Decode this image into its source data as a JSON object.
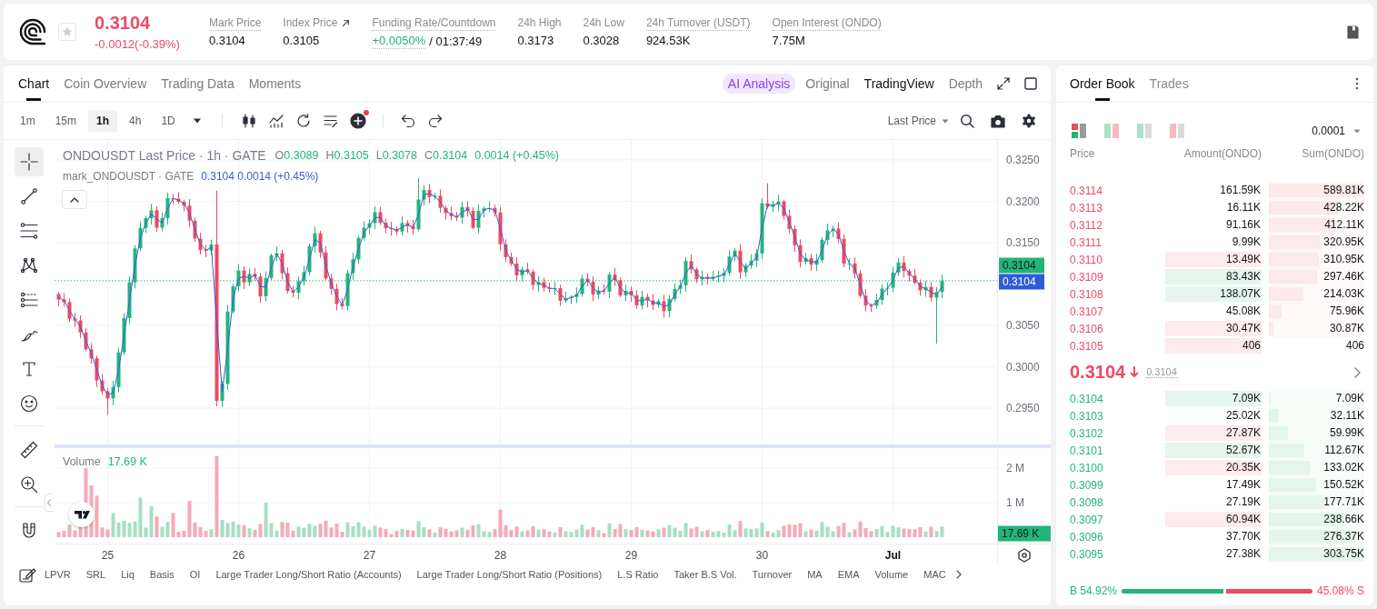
{
  "header": {
    "last_price": "0.3104",
    "change": "-0.0012(-0.39%)",
    "falling": true,
    "favorite": false,
    "stats": [
      {
        "kind": "plain",
        "label": "Mark Price",
        "tooltip": true,
        "value": "0.3104"
      },
      {
        "kind": "link",
        "label": "Index Price",
        "tooltip": false,
        "value": "0.3105"
      },
      {
        "kind": "funding",
        "label": "Funding Rate/Countdown",
        "tooltip": true,
        "value": "+0.0050%",
        "countdown": "/ 01:37:49"
      },
      {
        "kind": "plain",
        "label": "24h High",
        "tooltip": false,
        "value": "0.3173"
      },
      {
        "kind": "plain",
        "label": "24h Low",
        "tooltip": false,
        "value": "0.3028"
      },
      {
        "kind": "plain",
        "label": "24h Turnover (USDT)",
        "tooltip": true,
        "value": "924.53K"
      },
      {
        "kind": "plain",
        "label": "Open Interest (ONDO)",
        "tooltip": true,
        "value": "7.75M"
      }
    ]
  },
  "chart_panel": {
    "tabs": [
      {
        "label": "Chart",
        "selected": true
      },
      {
        "label": "Coin Overview",
        "selected": false
      },
      {
        "label": "Trading Data",
        "selected": false
      },
      {
        "label": "Moments",
        "selected": false
      }
    ],
    "ai_analysis": "AI Analysis",
    "views": [
      {
        "label": "Original",
        "selected": false
      },
      {
        "label": "TradingView",
        "selected": true
      },
      {
        "label": "Depth",
        "selected": false
      }
    ],
    "intervals": [
      {
        "label": "1m",
        "selected": false
      },
      {
        "label": "15m",
        "selected": false
      },
      {
        "label": "1h",
        "selected": true
      },
      {
        "label": "4h",
        "selected": false
      },
      {
        "label": "1D",
        "selected": false
      }
    ],
    "indicator_badge": true,
    "price_source": "Last Price",
    "drawing_tools": [
      [
        {
          "kind": "crosshair",
          "selected": true
        },
        {
          "kind": "trend-line",
          "selected": false
        },
        {
          "kind": "horizontal-lines",
          "selected": false
        },
        {
          "kind": "pattern",
          "selected": false
        },
        {
          "kind": "channel",
          "selected": false
        },
        {
          "kind": "brush",
          "selected": false
        },
        {
          "kind": "text",
          "selected": false
        },
        {
          "kind": "emoji",
          "selected": false
        }
      ],
      [
        {
          "kind": "ruler",
          "selected": false
        },
        {
          "kind": "zoom-in",
          "selected": false
        }
      ],
      [
        {
          "kind": "magnet",
          "selected": false
        }
      ]
    ],
    "legend": {
      "title": "ONDOUSDT Last Price · 1h · GATE",
      "ohlc": [
        {
          "key": "O",
          "value": "0.3089"
        },
        {
          "key": "H",
          "value": "0.3105"
        },
        {
          "key": "L",
          "value": "0.3078"
        },
        {
          "key": "C",
          "value": "0.3104"
        }
      ],
      "change": "0.0014 (+0.45%)",
      "mark_title": "mark_ONDOUSDT · GATE",
      "mark_values": "0.3104 0.0014 (+0.45%)",
      "expanded": true
    },
    "price_axis": [
      "0.3250",
      "0.3200",
      "0.3150",
      "0.3050",
      "0.3000",
      "0.2950"
    ],
    "last_price_tag": "0.3104",
    "mark_price_tag": "0.3104",
    "volume": {
      "title": "Volume",
      "value": "17.69 K",
      "axis": [
        "2 M",
        "1 M"
      ],
      "tag": "17.69 K"
    },
    "time_axis": [
      {
        "label": "25",
        "kind": "day"
      },
      {
        "label": "26",
        "kind": "day"
      },
      {
        "label": "27",
        "kind": "day"
      },
      {
        "label": "28",
        "kind": "day"
      },
      {
        "label": "29",
        "kind": "day"
      },
      {
        "label": "30",
        "kind": "day"
      },
      {
        "label": "Jul",
        "kind": "month"
      }
    ],
    "indicators": [
      "LPVR",
      "SRL",
      "Liq",
      "Basis",
      "OI",
      "Large Trader Long/Short Ratio (Accounts)",
      "Large Trader Long/Short Ratio (Positions)",
      "L.S Ratio",
      "Taker B.S Vol.",
      "Turnover",
      "MA",
      "EMA",
      "Volume",
      "MAC"
    ]
  },
  "order_book": {
    "tabs": [
      {
        "label": "Order Book",
        "selected": true
      },
      {
        "label": "Trades",
        "selected": false
      }
    ],
    "layouts": [
      {
        "kind": "both",
        "selected": true
      },
      {
        "kind": "split",
        "selected": false
      },
      {
        "kind": "bids",
        "selected": false
      },
      {
        "kind": "asks",
        "selected": false
      }
    ],
    "precision": "0.0001",
    "columns": [
      "Price",
      "Amount(ONDO)",
      "Sum(ONDO)"
    ],
    "asks": [
      {
        "price": "0.3114",
        "amount": "161.59K",
        "sum": "589.81K",
        "kind": "plain",
        "level": 1
      },
      {
        "price": "0.3113",
        "amount": "16.11K",
        "sum": "428.22K",
        "kind": "plain",
        "level": 0.726
      },
      {
        "price": "0.3112",
        "amount": "91.16K",
        "sum": "412.11K",
        "kind": "plain",
        "level": 0.699
      },
      {
        "price": "0.3111",
        "amount": "9.99K",
        "sum": "320.95K",
        "kind": "plain",
        "level": 0.544
      },
      {
        "price": "0.3110",
        "amount": "13.49K",
        "sum": "310.95K",
        "kind": "down",
        "level": 0.527
      },
      {
        "price": "0.3109",
        "amount": "83.43K",
        "sum": "297.46K",
        "kind": "up",
        "level": 0.504
      },
      {
        "price": "0.3108",
        "amount": "138.07K",
        "sum": "214.03K",
        "kind": "up",
        "level": 0.363
      },
      {
        "price": "0.3107",
        "amount": "45.08K",
        "sum": "75.96K",
        "kind": "plain",
        "level": 0.129
      },
      {
        "price": "0.3106",
        "amount": "30.47K",
        "sum": "30.87K",
        "kind": "down",
        "level": 0.052
      },
      {
        "price": "0.3105",
        "amount": "406",
        "sum": "406",
        "kind": "down"
      }
    ],
    "mid": {
      "price": "0.3104",
      "mark": "0.3104",
      "falling": true
    },
    "bids": [
      {
        "price": "0.3104",
        "amount": "7.09K",
        "sum": "7.09K",
        "kind": "up",
        "level": 0.023
      },
      {
        "price": "0.3103",
        "amount": "25.02K",
        "sum": "32.11K",
        "kind": "plain",
        "level": 0.106
      },
      {
        "price": "0.3102",
        "amount": "27.87K",
        "sum": "59.99K",
        "kind": "down",
        "level": 0.197
      },
      {
        "price": "0.3101",
        "amount": "52.67K",
        "sum": "112.67K",
        "kind": "up",
        "level": 0.371
      },
      {
        "price": "0.3100",
        "amount": "20.35K",
        "sum": "133.02K",
        "kind": "down",
        "level": 0.438
      },
      {
        "price": "0.3099",
        "amount": "17.49K",
        "sum": "150.52K",
        "kind": "plain",
        "level": 0.496
      },
      {
        "price": "0.3098",
        "amount": "27.19K",
        "sum": "177.71K",
        "kind": "plain",
        "level": 0.585
      },
      {
        "price": "0.3097",
        "amount": "60.94K",
        "sum": "238.66K",
        "kind": "down",
        "level": 0.786
      },
      {
        "price": "0.3096",
        "amount": "37.70K",
        "sum": "276.37K",
        "kind": "plain",
        "level": 0.91
      },
      {
        "price": "0.3095",
        "amount": "27.38K",
        "sum": "303.75K",
        "kind": "plain",
        "level": 1
      }
    ],
    "ratio": {
      "buy": "B 54.92%",
      "sell": "45.08% S",
      "level": 0.5492
    }
  }
}
